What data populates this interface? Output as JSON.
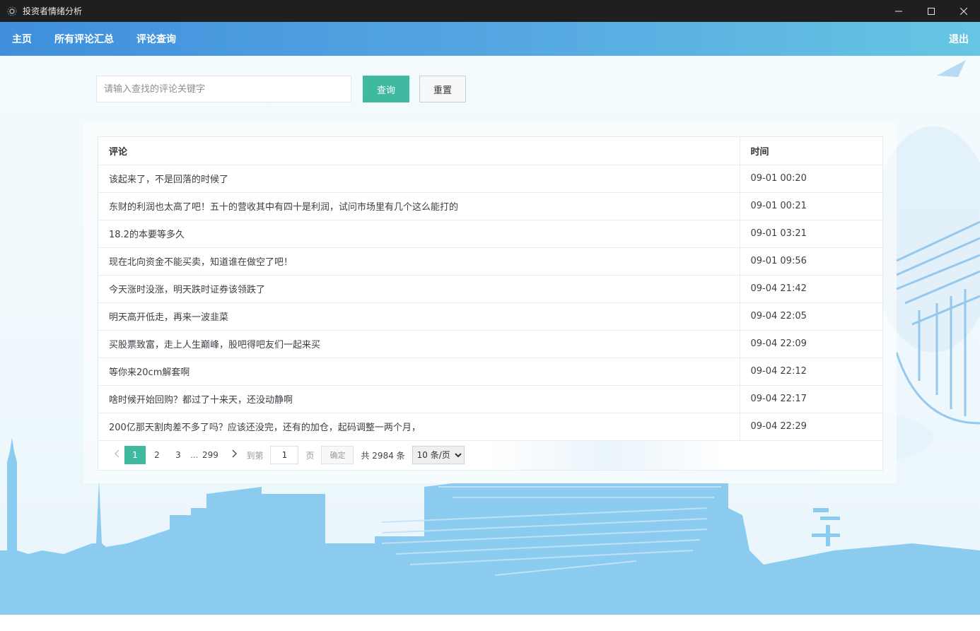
{
  "window": {
    "title": "投资者情绪分析"
  },
  "nav": {
    "items": [
      {
        "label": "主页"
      },
      {
        "label": "所有评论汇总"
      },
      {
        "label": "评论查询"
      }
    ],
    "logout": "退出"
  },
  "search": {
    "placeholder": "请输入查找的评论关键字",
    "value": "",
    "query_label": "查询",
    "reset_label": "重置"
  },
  "table": {
    "columns": [
      "评论",
      "时间"
    ],
    "rows": [
      {
        "comment": "该起来了，不是回落的时候了",
        "time": "09-01 00:20"
      },
      {
        "comment": "东财的利润也太高了吧！五十的营收其中有四十是利润，试问市场里有几个这么能打的",
        "time": "09-01 00:21"
      },
      {
        "comment": "18.2的本要等多久",
        "time": "09-01 03:21"
      },
      {
        "comment": "现在北向资金不能买卖，知道谁在做空了吧！",
        "time": "09-01 09:56"
      },
      {
        "comment": "今天涨时没涨，明天跌时证券该领跌了",
        "time": "09-04 21:42"
      },
      {
        "comment": "明天高开低走，再来一波韭菜",
        "time": "09-04 22:05"
      },
      {
        "comment": "买股票致富，走上人生巅峰，股吧得吧友们一起来买",
        "time": "09-04 22:09"
      },
      {
        "comment": "等你来20cm解套啊",
        "time": "09-04 22:12"
      },
      {
        "comment": "啥时候开始回购？都过了十来天，还没动静啊",
        "time": "09-04 22:17"
      },
      {
        "comment": "200亿那天割肉差不多了吗？应该还没完，还有的加仓，起码调整一两个月，",
        "time": "09-04 22:29"
      }
    ]
  },
  "pagination": {
    "prev_icon": "chevron-left-icon",
    "next_icon": "chevron-right-icon",
    "pages": [
      "1",
      "2",
      "3"
    ],
    "active_page": "1",
    "ellipsis": "...",
    "last_page": "299",
    "goto_label": "到第",
    "goto_value": "1",
    "page_unit": "页",
    "confirm_label": "确定",
    "total_text": "共 2984 条",
    "page_size_options": [
      "10 条/页"
    ],
    "page_size_selected": "10 条/页"
  },
  "colors": {
    "nav_gradient_start": "#3f8fdc",
    "nav_gradient_end": "#67c6e3",
    "accent": "#3fb99f",
    "titlebar": "#1f1f1f",
    "skyline": "#8ccbf0"
  }
}
